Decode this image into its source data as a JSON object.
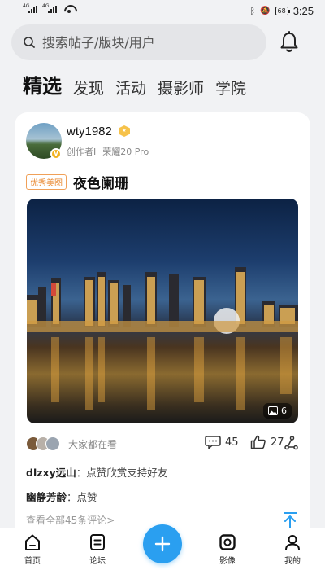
{
  "status_bar": {
    "signal1": "4G",
    "signal2": "4G",
    "battery": "68",
    "time": "3:25"
  },
  "search": {
    "placeholder": "搜索帖子/版块/用户"
  },
  "tabs": [
    {
      "label": "精选",
      "active": true
    },
    {
      "label": "发现",
      "active": false
    },
    {
      "label": "活动",
      "active": false
    },
    {
      "label": "摄影师",
      "active": false
    },
    {
      "label": "学院",
      "active": false
    }
  ],
  "post": {
    "username": "wty1982",
    "role": "创作者I",
    "device": "荣耀20 Pro",
    "tag": "优秀美图",
    "title": "夜色阑珊",
    "image_count": "6",
    "watching_text": "大家都在看",
    "comments_count": "45",
    "likes_count": "27"
  },
  "comments": [
    {
      "user": "dlzxy远山",
      "text": "点赞欣赏支持好友"
    },
    {
      "user": "幽静芳龄",
      "text": "点赞"
    }
  ],
  "view_all": "查看全部45条评论>",
  "bottom_nav": [
    {
      "label": "首页",
      "icon": "home-icon"
    },
    {
      "label": "论坛",
      "icon": "forum-icon"
    },
    {
      "label": "",
      "icon": "plus-icon"
    },
    {
      "label": "影像",
      "icon": "camera-icon"
    },
    {
      "label": "我的",
      "icon": "profile-icon"
    }
  ],
  "colors": {
    "accent": "#2a9ff0",
    "tag": "#e8862c",
    "badge": "#f2b11c"
  }
}
